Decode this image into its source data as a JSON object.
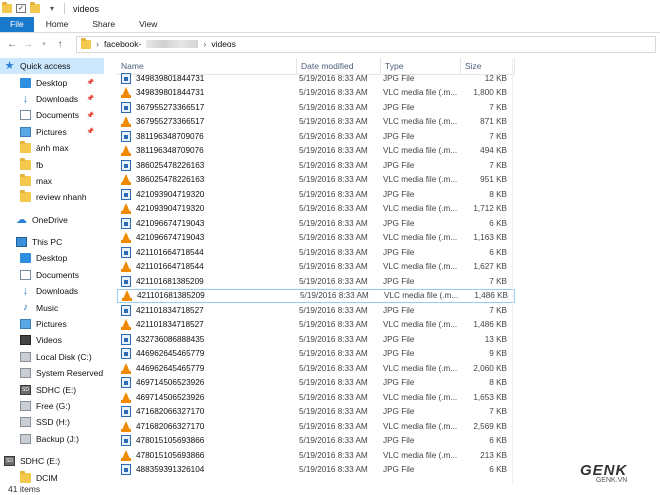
{
  "window": {
    "title": "videos"
  },
  "ribbon": {
    "tabs": [
      "File",
      "Home",
      "Share",
      "View"
    ]
  },
  "address": {
    "crumbs": [
      "facebook-",
      "videos"
    ]
  },
  "sidebar": {
    "items": [
      {
        "label": "Quick access",
        "icon": "star-icon",
        "selected": true
      },
      {
        "label": "Desktop",
        "icon": "desktop-icon",
        "pinned": true
      },
      {
        "label": "Downloads",
        "icon": "download-icon",
        "pinned": true
      },
      {
        "label": "Documents",
        "icon": "documents-icon",
        "pinned": true
      },
      {
        "label": "Pictures",
        "icon": "pictures-icon",
        "pinned": true
      },
      {
        "label": "ảnh max",
        "icon": "folder-icon"
      },
      {
        "label": "fb",
        "icon": "folder-icon"
      },
      {
        "label": "max",
        "icon": "folder-icon"
      },
      {
        "label": "review nhanh",
        "icon": "folder-icon"
      },
      {
        "label": "OneDrive",
        "icon": "onedrive-icon"
      },
      {
        "label": "This PC",
        "icon": "this-pc-icon"
      },
      {
        "label": "Desktop",
        "icon": "desktop-icon"
      },
      {
        "label": "Documents",
        "icon": "documents-icon"
      },
      {
        "label": "Downloads",
        "icon": "download-icon"
      },
      {
        "label": "Music",
        "icon": "music-icon"
      },
      {
        "label": "Pictures",
        "icon": "pictures-icon"
      },
      {
        "label": "Videos",
        "icon": "videos-icon"
      },
      {
        "label": "Local Disk (C:)",
        "icon": "drive-icon"
      },
      {
        "label": "System Reserved",
        "icon": "drive-icon"
      },
      {
        "label": "SDHC (E:)",
        "icon": "sd-card-icon"
      },
      {
        "label": "Free (G:)",
        "icon": "drive-icon"
      },
      {
        "label": "SSD (H:)",
        "icon": "drive-icon"
      },
      {
        "label": "Backup (J:)",
        "icon": "drive-icon"
      },
      {
        "label": "SDHC (E:)",
        "icon": "sd-card-icon"
      },
      {
        "label": "DCIM",
        "icon": "folder-icon"
      }
    ]
  },
  "columns": {
    "name": "Name",
    "date": "Date modified",
    "type": "Type",
    "size": "Size"
  },
  "files": [
    {
      "name": "349839801844731",
      "date": "5/19/2016 8:33 AM",
      "type": "JPG File",
      "size": "12 KB",
      "kind": "jpg"
    },
    {
      "name": "349839801844731",
      "date": "5/19/2016 8:33 AM",
      "type": "VLC media file (.m...",
      "size": "1,800 KB",
      "kind": "vlc"
    },
    {
      "name": "367955273366517",
      "date": "5/19/2016 8:33 AM",
      "type": "JPG File",
      "size": "7 KB",
      "kind": "jpg"
    },
    {
      "name": "367955273366517",
      "date": "5/19/2016 8:33 AM",
      "type": "VLC media file (.m...",
      "size": "871 KB",
      "kind": "vlc"
    },
    {
      "name": "381196348709076",
      "date": "5/19/2016 8:33 AM",
      "type": "JPG File",
      "size": "7 KB",
      "kind": "jpg"
    },
    {
      "name": "381196348709076",
      "date": "5/19/2016 8:33 AM",
      "type": "VLC media file (.m...",
      "size": "494 KB",
      "kind": "vlc"
    },
    {
      "name": "386025478226163",
      "date": "5/19/2016 8:33 AM",
      "type": "JPG File",
      "size": "7 KB",
      "kind": "jpg"
    },
    {
      "name": "386025478226163",
      "date": "5/19/2016 8:33 AM",
      "type": "VLC media file (.m...",
      "size": "951 KB",
      "kind": "vlc"
    },
    {
      "name": "421093904719320",
      "date": "5/19/2016 8:33 AM",
      "type": "JPG File",
      "size": "8 KB",
      "kind": "jpg"
    },
    {
      "name": "421093904719320",
      "date": "5/19/2016 8:33 AM",
      "type": "VLC media file (.m...",
      "size": "1,712 KB",
      "kind": "vlc"
    },
    {
      "name": "421096674719043",
      "date": "5/19/2016 8:33 AM",
      "type": "JPG File",
      "size": "6 KB",
      "kind": "jpg"
    },
    {
      "name": "421096674719043",
      "date": "5/19/2016 8:33 AM",
      "type": "VLC media file (.m...",
      "size": "1,163 KB",
      "kind": "vlc"
    },
    {
      "name": "421101664718544",
      "date": "5/19/2016 8:33 AM",
      "type": "JPG File",
      "size": "6 KB",
      "kind": "jpg"
    },
    {
      "name": "421101664718544",
      "date": "5/19/2016 8:33 AM",
      "type": "VLC media file (.m...",
      "size": "1,627 KB",
      "kind": "vlc"
    },
    {
      "name": "421101681385209",
      "date": "5/19/2016 8:33 AM",
      "type": "JPG File",
      "size": "7 KB",
      "kind": "jpg"
    },
    {
      "name": "421101681385209",
      "date": "5/19/2016 8:33 AM",
      "type": "VLC media file (.m...",
      "size": "1,486 KB",
      "kind": "vlc",
      "focused": true
    },
    {
      "name": "421101834718527",
      "date": "5/19/2016 8:33 AM",
      "type": "JPG File",
      "size": "7 KB",
      "kind": "jpg"
    },
    {
      "name": "421101834718527",
      "date": "5/19/2016 8:33 AM",
      "type": "VLC media file (.m...",
      "size": "1,486 KB",
      "kind": "vlc"
    },
    {
      "name": "432736086888435",
      "date": "5/19/2016 8:33 AM",
      "type": "JPG File",
      "size": "13 KB",
      "kind": "jpg"
    },
    {
      "name": "446962645465779",
      "date": "5/19/2016 8:33 AM",
      "type": "JPG File",
      "size": "9 KB",
      "kind": "jpg"
    },
    {
      "name": "446962645465779",
      "date": "5/19/2016 8:33 AM",
      "type": "VLC media file (.m...",
      "size": "2,060 KB",
      "kind": "vlc"
    },
    {
      "name": "469714506523926",
      "date": "5/19/2016 8:33 AM",
      "type": "JPG File",
      "size": "8 KB",
      "kind": "jpg"
    },
    {
      "name": "469714506523926",
      "date": "5/19/2016 8:33 AM",
      "type": "VLC media file (.m...",
      "size": "1,653 KB",
      "kind": "vlc"
    },
    {
      "name": "471682066327170",
      "date": "5/19/2016 8:33 AM",
      "type": "JPG File",
      "size": "7 KB",
      "kind": "jpg"
    },
    {
      "name": "471682066327170",
      "date": "5/19/2016 8:33 AM",
      "type": "VLC media file (.m...",
      "size": "2,569 KB",
      "kind": "vlc"
    },
    {
      "name": "478015105693866",
      "date": "5/19/2016 8:33 AM",
      "type": "JPG File",
      "size": "6 KB",
      "kind": "jpg"
    },
    {
      "name": "478015105693866",
      "date": "5/19/2016 8:33 AM",
      "type": "VLC media file (.m...",
      "size": "213 KB",
      "kind": "vlc"
    },
    {
      "name": "488359391326104",
      "date": "5/19/2016 8:33 AM",
      "type": "JPG File",
      "size": "6 KB",
      "kind": "jpg"
    }
  ],
  "status": {
    "count": "41 items"
  },
  "watermark": {
    "logo": "GENK",
    "sub": "GENK.VN"
  }
}
